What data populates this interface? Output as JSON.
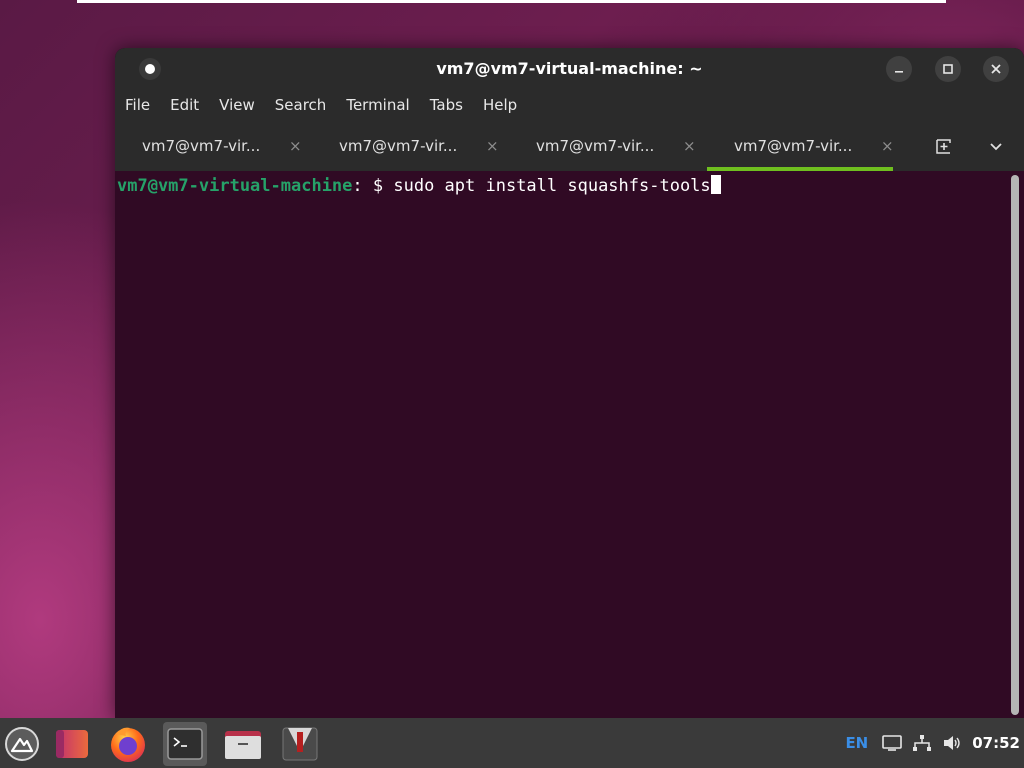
{
  "window": {
    "title": "vm7@vm7-virtual-machine: ~"
  },
  "menu": {
    "items": [
      "File",
      "Edit",
      "View",
      "Search",
      "Terminal",
      "Tabs",
      "Help"
    ]
  },
  "tabs": [
    {
      "label": "vm7@vm7-vir...",
      "active": false
    },
    {
      "label": "vm7@vm7-vir...",
      "active": false
    },
    {
      "label": "vm7@vm7-vir...",
      "active": false
    },
    {
      "label": "vm7@vm7-vir...",
      "active": true
    }
  ],
  "tab_close_glyph": "×",
  "terminal": {
    "prompt_user_host": "vm7@vm7-virtual-machine",
    "prompt_path": ":",
    "prompt_symbol": " $ ",
    "command": "sudo apt install squashfs-tools"
  },
  "taskbar": {
    "apps": [
      "start-menu-icon",
      "app-launcher-icon",
      "firefox-icon",
      "terminal-icon",
      "file-manager-icon",
      "installer-icon"
    ]
  },
  "tray": {
    "language": "EN",
    "clock": "07:52"
  },
  "colors": {
    "accent_tab": "#6fbf1f",
    "prompt_green": "#26a269",
    "terminal_bg": "#300a24",
    "lang_blue": "#3a8ee6"
  }
}
